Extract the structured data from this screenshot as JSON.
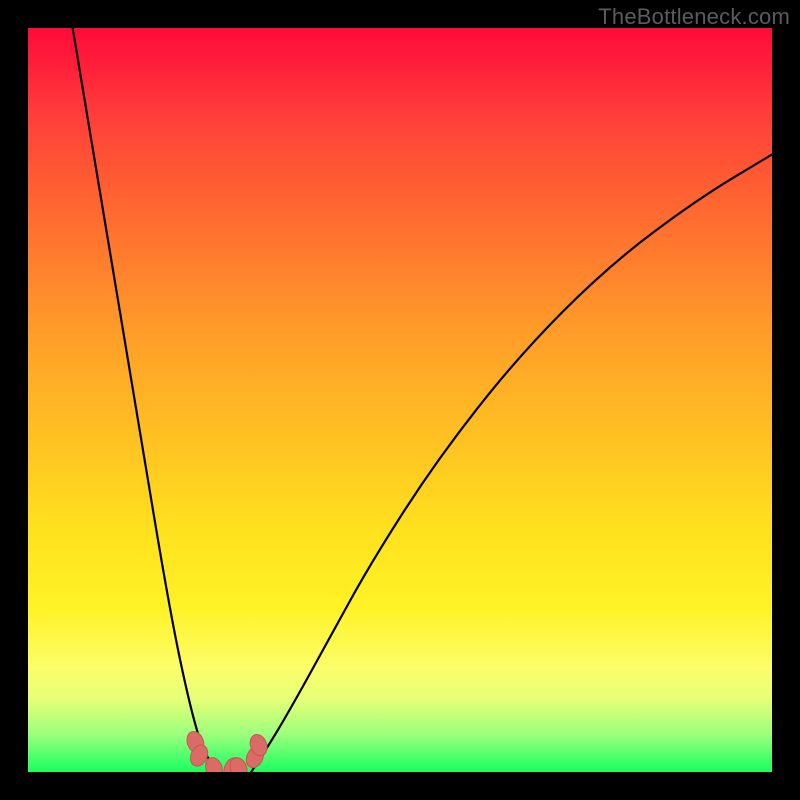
{
  "watermark": "TheBottleneck.com",
  "chart_data": {
    "type": "line",
    "title": "",
    "xlabel": "",
    "ylabel": "",
    "xlim": [
      0,
      100
    ],
    "ylim": [
      0,
      100
    ],
    "background_gradient": {
      "top": "#ff0a3a",
      "bottom": "#18ff5e",
      "description": "vertical rainbow gradient red→orange→yellow→green"
    },
    "series": [
      {
        "name": "left-curve",
        "x": [
          6,
          8,
          10,
          12,
          14,
          16,
          18,
          20,
          22,
          23.5,
          24.8,
          25.5
        ],
        "values": [
          100,
          88,
          76,
          64,
          52,
          40,
          28,
          17,
          8,
          3,
          1,
          0
        ]
      },
      {
        "name": "right-curve",
        "x": [
          30,
          32,
          35,
          40,
          46,
          55,
          66,
          78,
          90,
          100
        ],
        "values": [
          0,
          3,
          8,
          17,
          28,
          42,
          56,
          68,
          77,
          83
        ]
      },
      {
        "name": "knot-points",
        "x": [
          22.5,
          23.0,
          25.0,
          27.5,
          28.3,
          30.5,
          31.0
        ],
        "values": [
          4.0,
          2.2,
          0.5,
          0.5,
          0.5,
          2.0,
          3.6
        ]
      }
    ]
  }
}
